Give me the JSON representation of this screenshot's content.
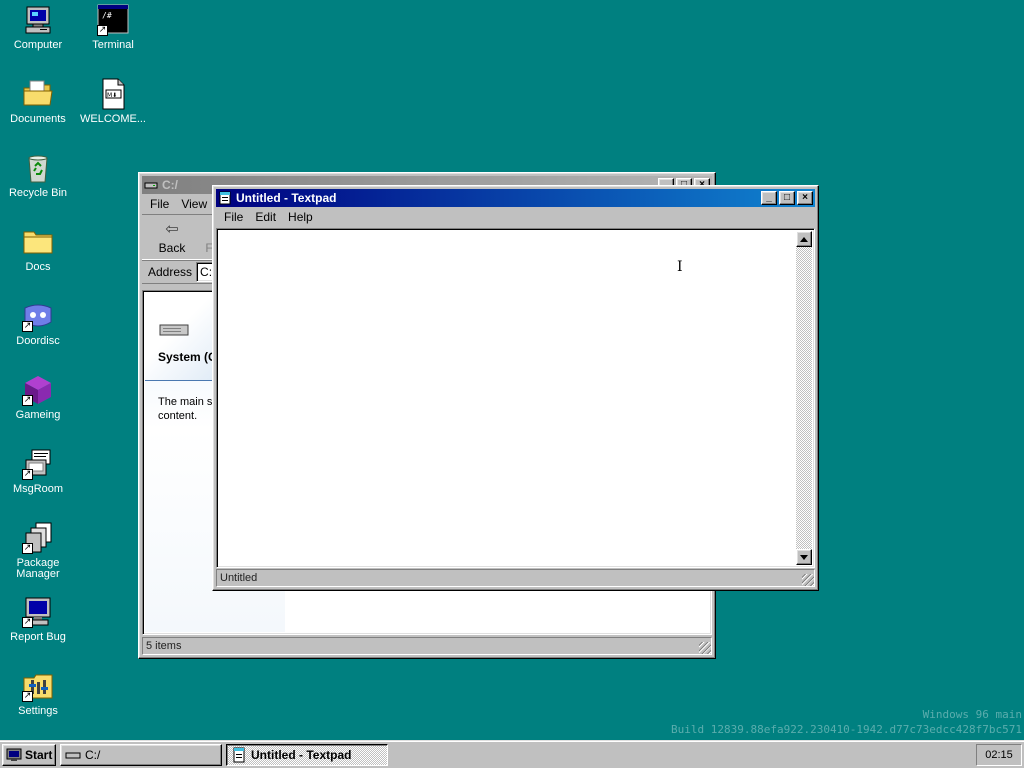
{
  "desktop": {
    "background": "#008080",
    "icons": [
      {
        "label": "Computer",
        "icon": "computer-icon"
      },
      {
        "label": "Terminal",
        "icon": "terminal-icon",
        "terminal_text": "/#"
      },
      {
        "label": "Documents",
        "icon": "documents-folder-icon"
      },
      {
        "label": "WELCOME...",
        "icon": "markdown-file-icon",
        "badge": "M⬇"
      },
      {
        "label": "Recycle Bin",
        "icon": "recycle-bin-icon"
      },
      {
        "label": "Docs",
        "icon": "folder-icon"
      },
      {
        "label": "Doordisc",
        "icon": "doordisc-icon"
      },
      {
        "label": "Gameing",
        "icon": "game-cube-icon"
      },
      {
        "label": "MsgRoom",
        "icon": "msgroom-icon"
      },
      {
        "label": "Package Manager",
        "icon": "package-manager-icon"
      },
      {
        "label": "Report Bug",
        "icon": "report-bug-icon"
      },
      {
        "label": "Settings",
        "icon": "settings-icon"
      }
    ],
    "watermark": {
      "line1": "Windows 96 main",
      "line2": "Build 12839.88efa922.230410-1942.d77c73edcc428f7bc571"
    }
  },
  "explorer": {
    "title": "C:/",
    "menu": [
      "File",
      "View"
    ],
    "toolbar": {
      "back_label": "Back",
      "forward_label": "F"
    },
    "address_label": "Address",
    "address_value": "C:/",
    "panel_title": "System (C",
    "panel_text": "The main st",
    "panel_text2": "content.",
    "status": "5 items"
  },
  "textpad": {
    "title": "Untitled - Textpad",
    "menu": [
      "File",
      "Edit",
      "Help"
    ],
    "content": "",
    "status": "Untitled"
  },
  "taskbar": {
    "start_label": "Start",
    "tasks": [
      {
        "label": "C:/",
        "active": false
      },
      {
        "label": "Untitled - Textpad",
        "active": true
      }
    ],
    "clock": "02:15"
  },
  "colors": {
    "title_active": "#000080",
    "title_inactive": "#808080",
    "face": "#c0c0c0"
  }
}
